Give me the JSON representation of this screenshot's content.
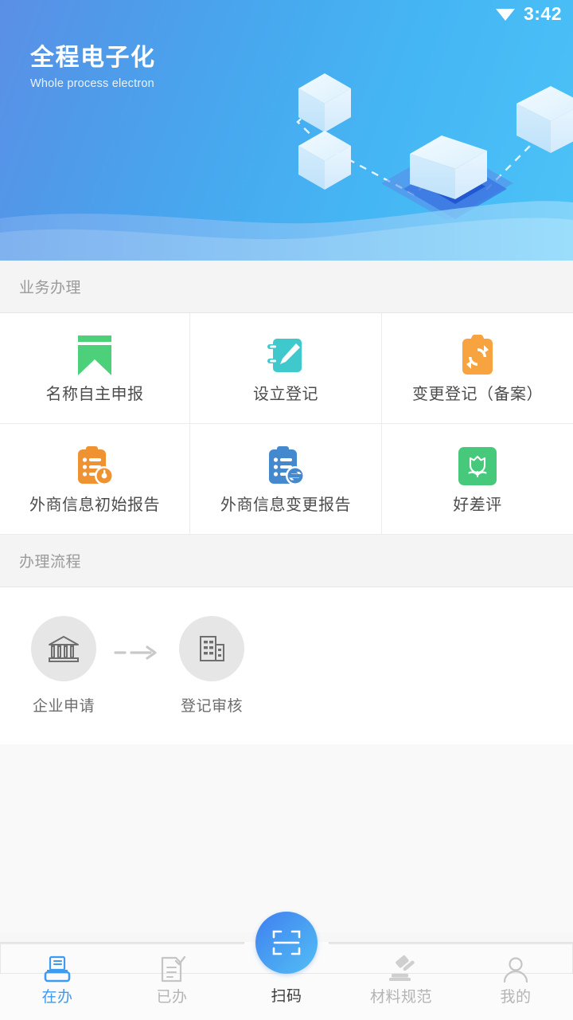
{
  "statusbar": {
    "time": "3:42",
    "wifi_icon": "wifi-icon"
  },
  "banner": {
    "title": "全程电子化",
    "subtitle": "Whole process electron",
    "gradient_from": "#5b8fe6",
    "gradient_to": "#4cc3f7"
  },
  "business_section": {
    "header": "业务办理",
    "items": [
      {
        "label": "名称自主申报",
        "icon": "bookmark-icon",
        "color": "#4cd07a"
      },
      {
        "label": "设立登记",
        "icon": "notebook-pencil-icon",
        "color": "#3fc9cd"
      },
      {
        "label": "变更登记（备案）",
        "icon": "clipboard-refresh-icon",
        "color": "#f7a440"
      },
      {
        "label": "外商信息初始报告",
        "icon": "clipboard-clock-icon",
        "color": "#ef9232"
      },
      {
        "label": "外商信息变更报告",
        "icon": "clipboard-exchange-icon",
        "color": "#4489cd"
      },
      {
        "label": "好差评",
        "icon": "tulip-icon",
        "color": "#46c97a"
      }
    ]
  },
  "flow_section": {
    "header": "办理流程",
    "steps": [
      {
        "label": "企业申请",
        "icon": "bank-icon"
      },
      {
        "label": "登记审核",
        "icon": "building-icon"
      }
    ],
    "connector_icon": "dashed-arrow-icon"
  },
  "tabbar": {
    "accent_color": "#3d9bf0",
    "inactive_color": "#b4b4b4",
    "tabs": [
      {
        "label": "在办",
        "icon": "printer-doc-icon",
        "active": true
      },
      {
        "label": "已办",
        "icon": "doc-check-icon",
        "active": false
      },
      {
        "label": "扫码",
        "icon": "scan-frame-icon",
        "active": false,
        "is_scan": true
      },
      {
        "label": "材料规范",
        "icon": "gavel-icon",
        "active": false
      },
      {
        "label": "我的",
        "icon": "user-icon",
        "active": false
      }
    ]
  }
}
